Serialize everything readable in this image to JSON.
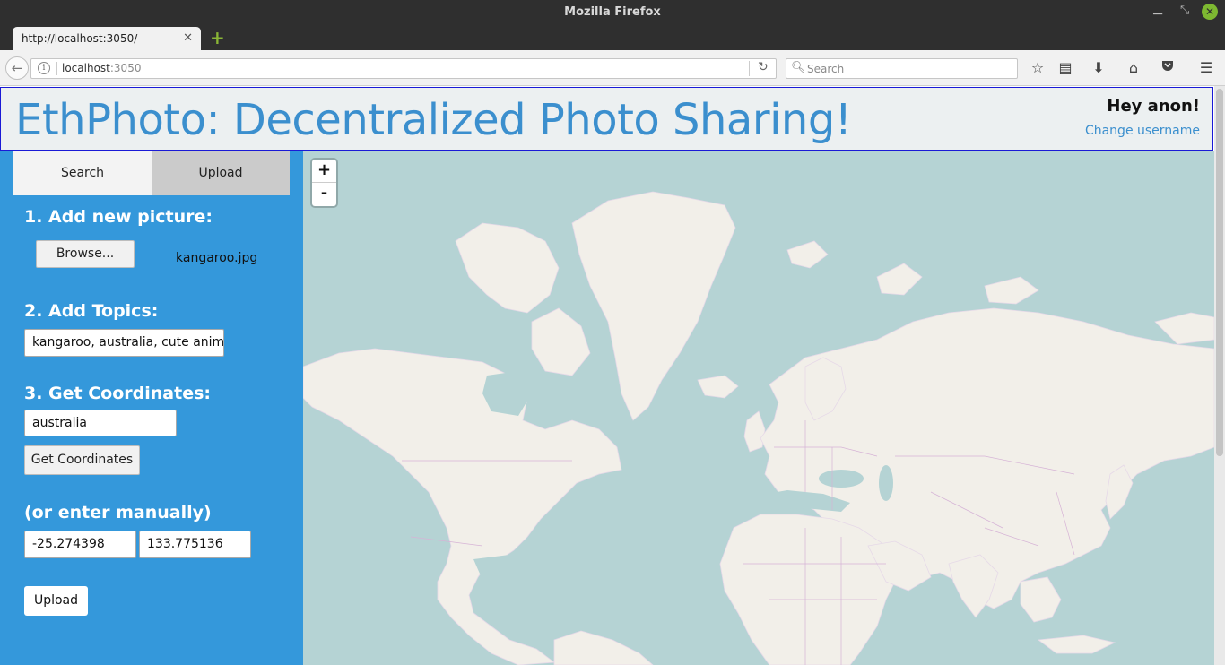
{
  "window": {
    "title": "Mozilla Firefox",
    "close_symbol": "✕"
  },
  "tab": {
    "title": "http://localhost:3050/",
    "close_symbol": "✕",
    "new_tab_symbol": "+"
  },
  "nav": {
    "url_host": "localhost",
    "url_port": ":3050",
    "search_placeholder": "Search",
    "icons": [
      "back-icon",
      "info-icon",
      "reload-icon",
      "search-icon",
      "bookmark-star-icon",
      "reading-list-icon",
      "download-icon",
      "home-icon",
      "pocket-icon",
      "menu-icon"
    ]
  },
  "header": {
    "title": "EthPhoto: Decentralized Photo Sharing!",
    "greeting": "Hey anon!",
    "change_username": "Change username"
  },
  "sidebar": {
    "tabs": {
      "search": "Search",
      "upload": "Upload"
    },
    "step1": "1. Add new picture:",
    "browse_label": "Browse...",
    "file_name": "kangaroo.jpg",
    "step2": "2. Add Topics:",
    "topics_value": "kangaroo, australia, cute animal",
    "step3": "3. Get Coordinates:",
    "location_value": "australia",
    "get_coords_label": "Get Coordinates",
    "manual_heading": "(or enter manually)",
    "latitude_value": "-25.274398",
    "longitude_value": "133.775136",
    "upload_label": "Upload"
  },
  "map": {
    "zoom_in": "+",
    "zoom_out": "-"
  },
  "colors": {
    "accent": "#3498db",
    "title_blue": "#3b8fce",
    "map_water": "#b5d3d4",
    "land": "#f2efe9"
  }
}
